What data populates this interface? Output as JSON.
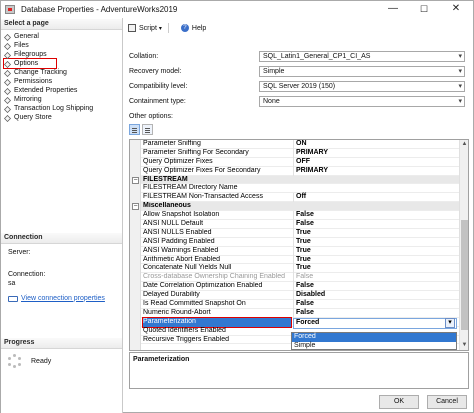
{
  "window": {
    "title": "Database Properties - AdventureWorks2019",
    "controls": {
      "minimize": "—",
      "maximize": "☐",
      "close": "✕"
    }
  },
  "left": {
    "select_page_header": "Select a page",
    "pages": [
      {
        "label": "General"
      },
      {
        "label": "Files"
      },
      {
        "label": "Filegroups"
      },
      {
        "label": "Options",
        "selected": true
      },
      {
        "label": "Change Tracking"
      },
      {
        "label": "Permissions"
      },
      {
        "label": "Extended Properties"
      },
      {
        "label": "Mirroring"
      },
      {
        "label": "Transaction Log Shipping"
      },
      {
        "label": "Query Store"
      }
    ],
    "connection_header": "Connection",
    "server_label": "Server:",
    "connection_label": "Connection:",
    "connection_value": "sa",
    "view_connection_link": "View connection properties",
    "progress_header": "Progress",
    "progress_status": "Ready"
  },
  "toolbar": {
    "script_label": "Script",
    "script_arrow": "▾",
    "help_label": "Help",
    "help_glyph": "?"
  },
  "form": {
    "collation_label": "Collation:",
    "collation_value": "SQL_Latin1_General_CP1_CI_AS",
    "recovery_label": "Recovery model:",
    "recovery_value": "Simple",
    "compat_label": "Compatibility level:",
    "compat_value": "SQL Server 2019 (150)",
    "containment_label": "Containment type:",
    "containment_value": "None",
    "other_options_label": "Other options:"
  },
  "propgrid": {
    "rows": [
      {
        "name": "Parameter Sniffing",
        "value": "ON"
      },
      {
        "name": "Parameter Sniffing For Secondary",
        "value": "PRIMARY"
      },
      {
        "name": "Query Optimizer Fixes",
        "value": "OFF"
      },
      {
        "name": "Query Optimizer Fixes For Secondary",
        "value": "PRIMARY"
      },
      {
        "name": "FILESTREAM",
        "value": "",
        "category": true,
        "expander": "−"
      },
      {
        "name": "FILESTREAM Directory Name",
        "value": ""
      },
      {
        "name": "FILESTREAM Non-Transacted Access",
        "value": "Off"
      },
      {
        "name": "Miscellaneous",
        "value": "",
        "category": true,
        "expander": "−"
      },
      {
        "name": "Allow Snapshot Isolation",
        "value": "False"
      },
      {
        "name": "ANSI NULL Default",
        "value": "False"
      },
      {
        "name": "ANSI NULLS Enabled",
        "value": "True"
      },
      {
        "name": "ANSI Padding Enabled",
        "value": "True"
      },
      {
        "name": "ANSI Warnings Enabled",
        "value": "True"
      },
      {
        "name": "Arithmetic Abort Enabled",
        "value": "True"
      },
      {
        "name": "Concatenate Null Yields Null",
        "value": "True"
      },
      {
        "name": "Cross-database Ownership Chaining Enabled",
        "value": "False",
        "disabled": true
      },
      {
        "name": "Date Correlation Optimization Enabled",
        "value": "False"
      },
      {
        "name": "Delayed Durability",
        "value": "Disabled"
      },
      {
        "name": "Is Read Committed Snapshot On",
        "value": "False"
      },
      {
        "name": "Numeric Round-Abort",
        "value": "False"
      },
      {
        "name": "Parameterization",
        "value": "Forced",
        "selected": true
      },
      {
        "name": "Quoted Identifiers Enabled",
        "value": ""
      },
      {
        "name": "Recursive Triggers Enabled",
        "value": ""
      }
    ],
    "dropdown_options": [
      "Forced",
      "Simple"
    ],
    "description_title": "Parameterization"
  },
  "buttons": {
    "ok": "OK",
    "cancel": "Cancel"
  }
}
